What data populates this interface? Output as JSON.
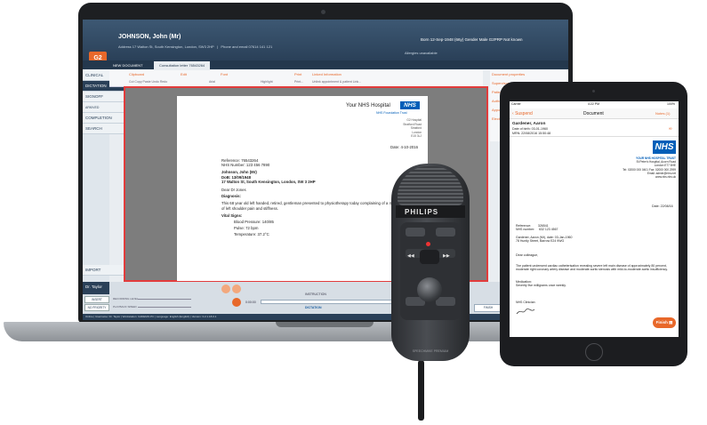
{
  "laptop_app": {
    "patient_name": "JOHNSON, John (Mr)",
    "address": "Address 17 Walton St, South Kensington, London, SW3 2HP",
    "phone": "Phone and email 07614 141 121",
    "born": "Born 12-Sep-1948 (66y) Gender Male G2PRP Not known",
    "allergies": "Allergies unavailable",
    "logo": "G2",
    "tabs": [
      "NEW DOCUMENT",
      "Consultation letter 76543264"
    ],
    "toolbar": [
      "Clipboard",
      "Edit",
      "Font",
      "Print",
      "Linked Information"
    ],
    "toolbar_sub": [
      "Cut  Copy  Paste  Undo  Redo",
      "Arial",
      "Highlight",
      "Print...",
      "Unlink appointment & patient   Link..."
    ],
    "nav": [
      "CLINICAL",
      "DICTATION",
      "SIGNOFF",
      "ARKIVED",
      "COMPLETION",
      "SEARCH"
    ],
    "nav_bottom": [
      "IMPORT",
      "Dr. Taylor"
    ],
    "right_panel": [
      "Document properties",
      "Supervisor",
      "Patients",
      "Author",
      "Appointments",
      "Electronic..."
    ],
    "doc": {
      "hospital": "Your NHS Hospital",
      "nhs": "NHS",
      "trust": "NHS Foundation Trust",
      "addr_lines": [
        "G2 Hospital",
        "Stratford Road",
        "Stratford",
        "London",
        "E15 3LJ"
      ],
      "date": "Date: 4-10-2016",
      "reference": "Reference: 76543264",
      "nhs_number": "NHS Number: 123 456 7890",
      "patient": "Johnson, John (Mr)",
      "dob": "DoB: 13/09/1948",
      "patient_addr": "17 Walton St, South Kensington, London, SW 3 2HP",
      "salutation": "Dear Dr Jones",
      "diagnosis": "Diagnosis:",
      "body": "This 68 year old left handed, retired, gentleman presented to physiotherapy today complaining of a 4-5 month history of left shoulder pain and stiffness.",
      "vital_signs": "Vital Signs:",
      "bp": "Blood Pressure: 140/85",
      "pulse": "Pulse: 72 bpm",
      "temp": "Temperature: 37.2°C"
    },
    "bottom": {
      "btn1": "INSERT",
      "btn2": "NO PRIORITY",
      "recording": "RECORDING LEVEL",
      "playback": "PLAYBACK SPEED",
      "time": "0:00:00",
      "instruction": "INSTRUCTION",
      "dictation": "DICTATION",
      "finish": "FINISH",
      "status": "Online | Username: Dr. Taylor | Workstation: G2DEMO-PC | Language: English (English) | Version: 3.2.1.18.0.1"
    }
  },
  "microphone": {
    "brand": "PHILIPS",
    "model": "SPEECHMIKE PREMIUM"
  },
  "ipad": {
    "status_left": "Carrier",
    "status_time": "4:22 PM",
    "status_right": "100%",
    "nav_back": "Suspend",
    "nav_title": "Document",
    "nav_right": "Notes (1)",
    "patient_name": "Gardener, Aaron",
    "dob": "Date of birth: 03-01-1960",
    "mrn": "MRN: 22/08/2016 15:50:48",
    "nhs": "NHS",
    "trust": "YOUR NHS HOSPITAL TRUST",
    "trust_addr": [
      "St Peter's Hospital, Acorn Road",
      "London E77 8HE",
      "Tel: 02000 000 0401  Fax: 02000 000 2999",
      "Email: admin@nhs.net",
      "www.nhs.nhs.uk"
    ],
    "date": "Date: 22/08/16",
    "reference_label": "Reference:",
    "reference": "326541",
    "nhs_label": "NHS number:",
    "nhs_number": "632 123 4567",
    "patient_line": "Gardener, Aaron (Mr), date: 03-Jan-1960",
    "patient_addr": "78 Huntly Street, Barrow E24 9WG",
    "greeting": "Dear colleague,",
    "body": "The patient underwent cardiac catheterisation revealing severe left main disease of approximately 80 percent, moderate right coronary artery disease and moderate aortic stenosis with mild-to-moderate aortic insufficiency.",
    "medication_label": "Medication:",
    "medication": "Severity five milligrams once weekly.",
    "signer": "NHS Clinician",
    "finish": "Finish"
  }
}
